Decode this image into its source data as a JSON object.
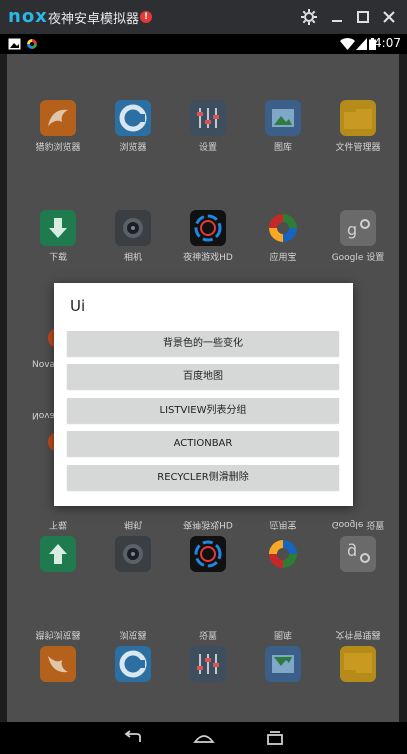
{
  "window": {
    "logo": "nox",
    "title": "夜神安卓模拟器",
    "alert": "!"
  },
  "status_bar": {
    "time": "4:07"
  },
  "home_apps": {
    "row1": [
      "猎豹浏览器",
      "浏览器",
      "设置",
      "图库",
      "文件管理器"
    ],
    "row2": [
      "下载",
      "相机",
      "夜神游戏HD",
      "应用宝",
      "Google 设置"
    ],
    "row3_partial": "Nova"
  },
  "dialog": {
    "title": "Ui",
    "buttons": [
      "背景色的一些变化",
      "百度地图",
      "LISTVIEW列表分组",
      "ACTIONBAR",
      "RECYCLER侧滑删除"
    ]
  },
  "colors": {
    "accent": "#2ab8e8",
    "alert": "#e53935",
    "dialog_button": "#d6d7d7"
  }
}
